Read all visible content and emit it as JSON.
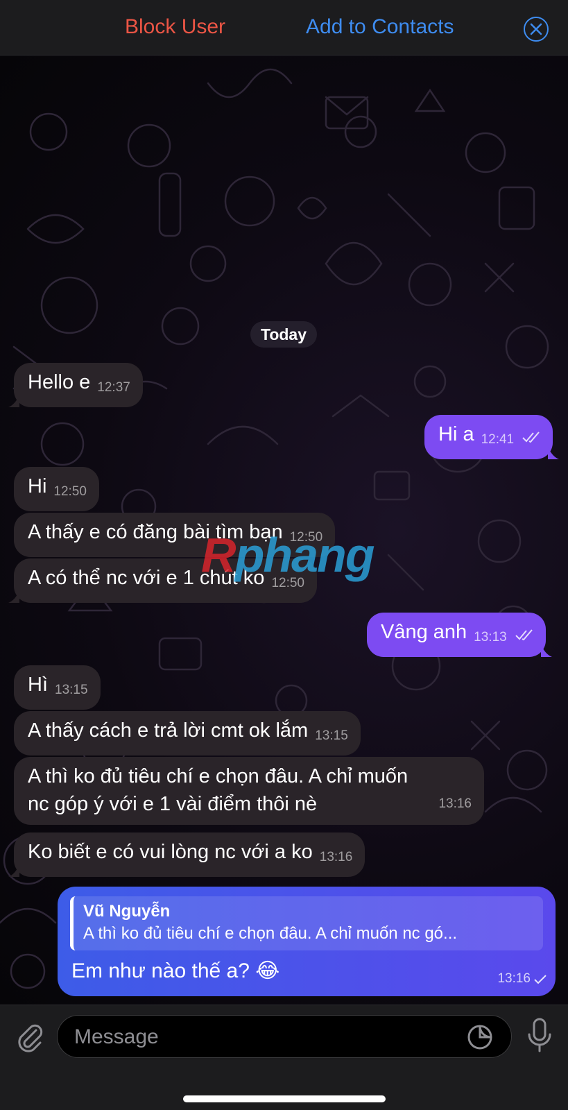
{
  "topbar": {
    "block_label": "Block User",
    "add_label": "Add to Contacts",
    "close_icon": "close-circle-icon",
    "block_color": "#eb5545",
    "accent_color": "#3e8cf0"
  },
  "chat": {
    "date_label": "Today",
    "messages": [
      {
        "dir": "in",
        "text": "Hello e",
        "time": "12:37"
      },
      {
        "dir": "out",
        "text": "Hi a",
        "time": "12:41",
        "status": "read"
      },
      {
        "dir": "in",
        "text": "Hi",
        "time": "12:50"
      },
      {
        "dir": "in",
        "text": "A thấy e có đăng bài tìm bạn",
        "time": "12:50"
      },
      {
        "dir": "in",
        "text": "A có thể nc với e 1 chút ko",
        "time": "12:50"
      },
      {
        "dir": "out",
        "text": "Vâng anh",
        "time": "13:13",
        "status": "read"
      },
      {
        "dir": "in",
        "text": "Hì",
        "time": "13:15"
      },
      {
        "dir": "in",
        "text": "A thấy cách e trả lời cmt ok lắm",
        "time": "13:15"
      },
      {
        "dir": "in",
        "lines": [
          "A thì ko đủ tiêu chí e chọn đâu. A chỉ muốn",
          "nc góp ý với e 1 vài điểm thôi nè"
        ],
        "time": "13:16"
      },
      {
        "dir": "in",
        "text": "Ko biết e có vui lòng nc với a ko",
        "time": "13:16"
      }
    ],
    "reply": {
      "author": "Vũ Nguyễn",
      "quoted": "A thì ko đủ tiêu chí e chọn đâu. A chỉ muốn nc gó...",
      "text": "Em như nào thế a? 😂",
      "time": "13:16",
      "status": "sent"
    },
    "incoming_color": "#2a2429",
    "outgoing_color": "#7d4bf2"
  },
  "watermark": {
    "first": "R",
    "rest": "phang"
  },
  "input": {
    "placeholder": "Message",
    "attach_icon": "paperclip-icon",
    "sticker_icon": "sticker-icon",
    "mic_icon": "microphone-icon"
  }
}
